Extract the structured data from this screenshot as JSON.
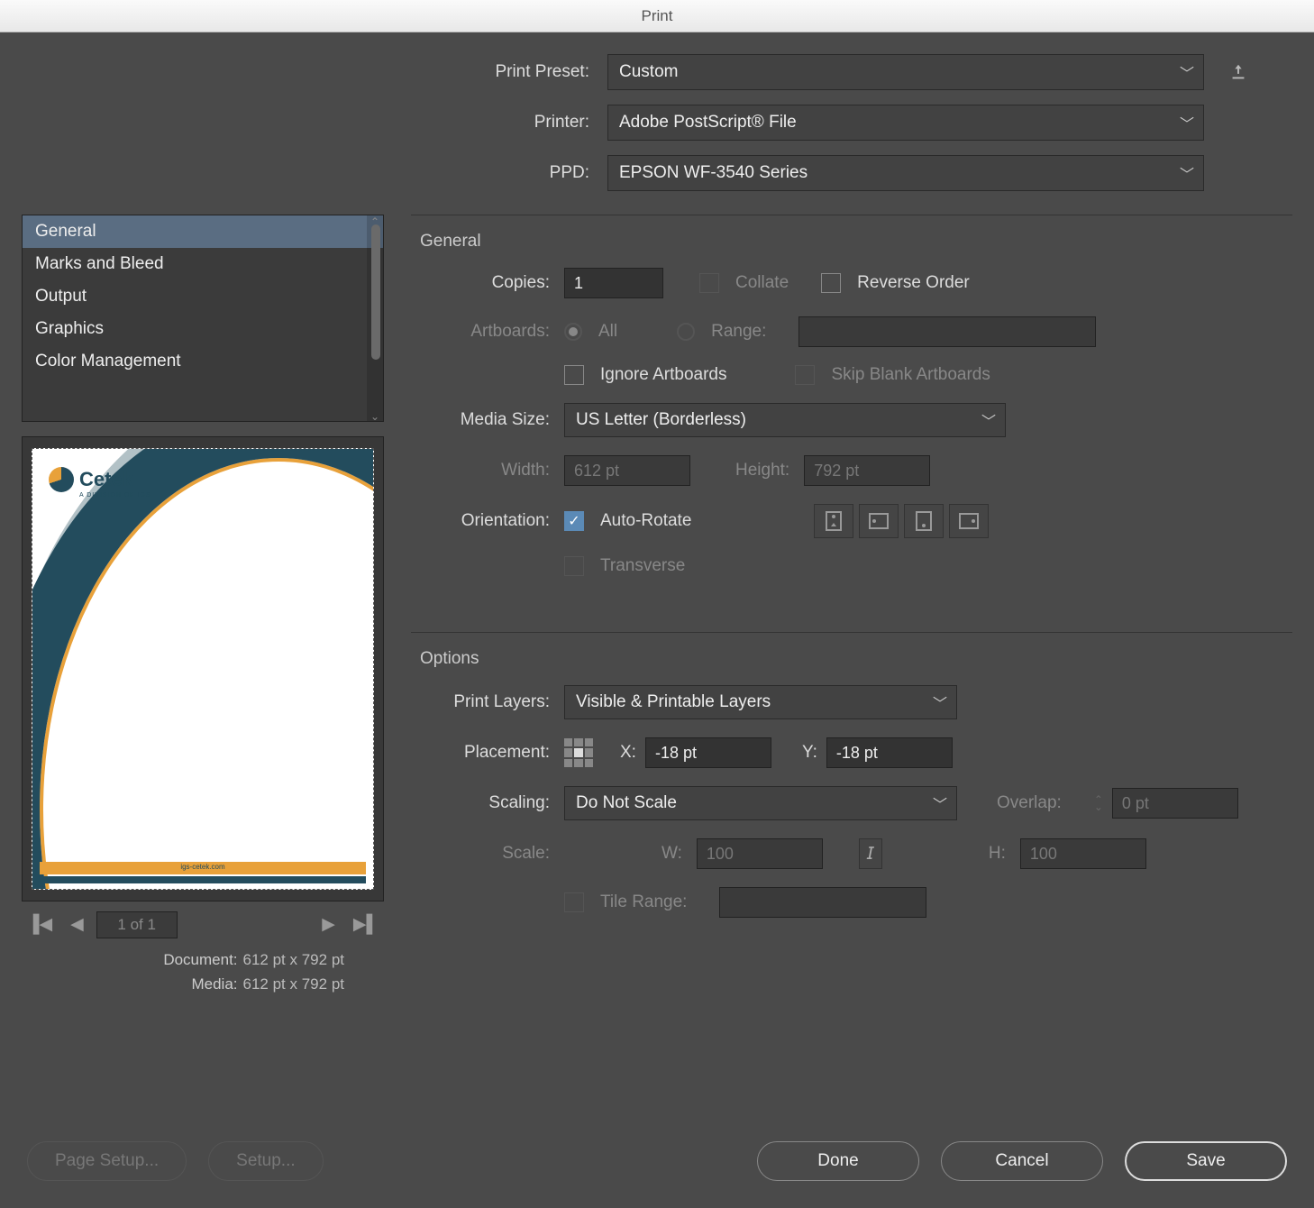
{
  "title": "Print",
  "preset": {
    "label": "Print Preset:",
    "value": "Custom"
  },
  "printer": {
    "label": "Printer:",
    "value": "Adobe PostScript® File"
  },
  "ppd": {
    "label": "PPD:",
    "value": "EPSON WF-3540 Series"
  },
  "sidebar": {
    "items": [
      "General",
      "Marks and Bleed",
      "Output",
      "Graphics",
      "Color Management"
    ],
    "selected": 0
  },
  "preview": {
    "logo_text": "Cetek",
    "logo_sub": "A DIVISION OF IGS",
    "footer_url": "igs-cetek.com"
  },
  "pager": {
    "text": "1 of 1"
  },
  "dims": {
    "doc_label": "Document:",
    "doc_value": "612 pt x 792 pt",
    "media_label": "Media:",
    "media_value": "612 pt x 792 pt"
  },
  "general": {
    "title": "General",
    "copies_label": "Copies:",
    "copies_value": "1",
    "collate_label": "Collate",
    "reverse_label": "Reverse Order",
    "artboards_label": "Artboards:",
    "all_label": "All",
    "range_label": "Range:",
    "ignore_label": "Ignore Artboards",
    "skip_label": "Skip Blank Artboards",
    "mediasize_label": "Media Size:",
    "mediasize_value": "US Letter (Borderless)",
    "width_label": "Width:",
    "width_value": "612 pt",
    "height_label": "Height:",
    "height_value": "792 pt",
    "orientation_label": "Orientation:",
    "autorotate_label": "Auto-Rotate",
    "transverse_label": "Transverse"
  },
  "options": {
    "title": "Options",
    "printlayers_label": "Print Layers:",
    "printlayers_value": "Visible & Printable Layers",
    "placement_label": "Placement:",
    "x_label": "X:",
    "x_value": "-18 pt",
    "y_label": "Y:",
    "y_value": "-18 pt",
    "scaling_label": "Scaling:",
    "scaling_value": "Do Not Scale",
    "overlap_label": "Overlap:",
    "overlap_value": "0 pt",
    "scale_label": "Scale:",
    "w_label": "W:",
    "w_value": "100",
    "h_label": "H:",
    "h_value": "100",
    "tilerange_label": "Tile Range:"
  },
  "buttons": {
    "pagesetup": "Page Setup...",
    "setup": "Setup...",
    "done": "Done",
    "cancel": "Cancel",
    "save": "Save"
  }
}
